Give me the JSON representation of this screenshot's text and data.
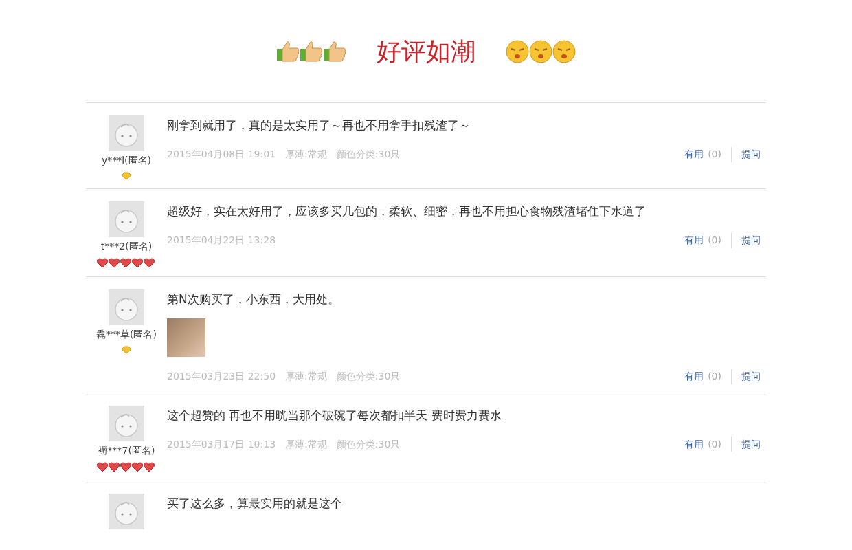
{
  "header": {
    "title": "好评如潮"
  },
  "reviews": [
    {
      "kind": "diamond",
      "user": "y***l(匿名)",
      "text": "刚拿到就用了，真的是太实用了～再也不用拿手扣残渣了～",
      "has_photo": false,
      "date": "2015年04月08日 19:01",
      "specs": [
        "厚薄:常规",
        "颜色分类:30只"
      ],
      "useful_label": "有用",
      "useful_count": "(0)",
      "ask_label": "提问"
    },
    {
      "kind": "hearts",
      "user": "t***2(匿名)",
      "text": "超级好，实在太好用了，应该多买几包的，柔软、细密，再也不用担心食物残渣堵住下水道了",
      "has_photo": false,
      "date": "2015年04月22日 13:28",
      "useful_label": "有用",
      "useful_count": "(0)",
      "ask_label": "提问"
    },
    {
      "kind": "diamond",
      "user": "毳***草(匿名)",
      "text": "第N次购买了，小东西，大用处。",
      "has_photo": true,
      "date": "2015年03月23日 22:50",
      "specs": [
        "厚薄:常规",
        "颜色分类:30只"
      ],
      "useful_label": "有用",
      "useful_count": "(0)",
      "ask_label": "提问"
    },
    {
      "kind": "hearts",
      "user": "褥***7(匿名)",
      "text": "这个超赞的 再也不用晄当那个破碗了每次都扣半天 费时费力费水",
      "has_photo": false,
      "date": "2015年03月17日 10:13",
      "specs": [
        "厚薄:常规",
        "颜色分类:30只"
      ],
      "useful_label": "有用",
      "useful_count": "(0)",
      "ask_label": "提问"
    },
    {
      "text": "买了这么多，算最实用的就是这个",
      "has_photo": false
    }
  ]
}
